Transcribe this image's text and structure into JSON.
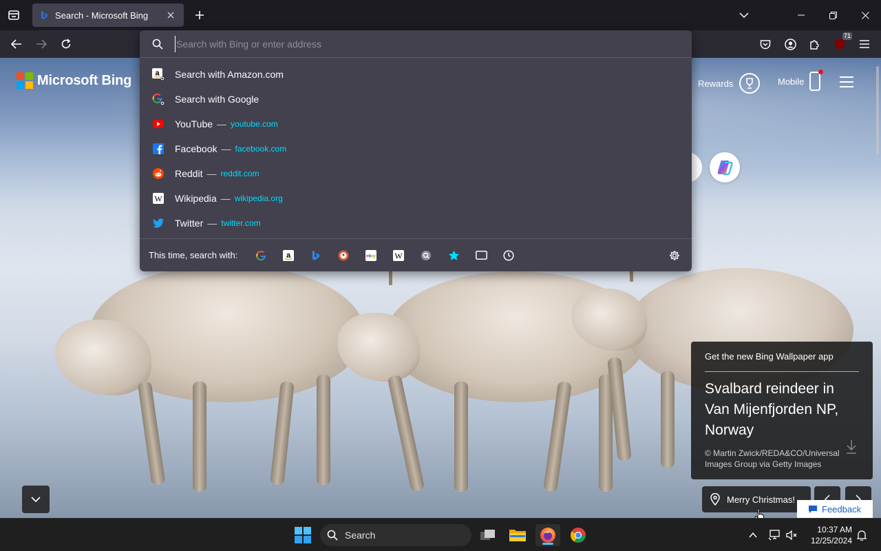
{
  "browser": {
    "tab": {
      "title": "Search - Microsoft Bing"
    },
    "extension_badge": "71"
  },
  "urlbar": {
    "placeholder": "Search with Bing or enter address",
    "results": [
      {
        "icon": "amazon-icon",
        "title": "Search with Amazon.com",
        "url": ""
      },
      {
        "icon": "google-icon",
        "title": "Search with Google",
        "url": ""
      },
      {
        "icon": "youtube-icon",
        "title": "YouTube",
        "url": "youtube.com"
      },
      {
        "icon": "facebook-icon",
        "title": "Facebook",
        "url": "facebook.com"
      },
      {
        "icon": "reddit-icon",
        "title": "Reddit",
        "url": "reddit.com"
      },
      {
        "icon": "wikipedia-icon",
        "title": "Wikipedia",
        "url": "wikipedia.org"
      },
      {
        "icon": "twitter-icon",
        "title": "Twitter",
        "url": "twitter.com"
      }
    ],
    "separator": "—",
    "oneoff_label": "This time, search with:"
  },
  "bing": {
    "logo_text": "Microsoft Bing",
    "rewards_label": "Rewards",
    "mobile_label": "Mobile",
    "wallpaper_app": "Get the new Bing Wallpaper app",
    "image_title": "Svalbard reindeer in Van Mijenfjorden NP, Norway",
    "image_credit": "© Martin Zwick/REDA&CO/Universal Images Group via Getty Images",
    "location_label": "Merry Christmas!",
    "feedback_label": "Feedback"
  },
  "taskbar": {
    "search_label": "Search",
    "time": "10:37 AM",
    "date": "12/25/2024"
  },
  "colors": {
    "browser_bg": "#1c1b22",
    "toolbar_bg": "#2b2a33",
    "dropdown_bg": "#42414d",
    "url_accent": "#00ddff",
    "taskbar_bg": "#1f1f1f"
  }
}
